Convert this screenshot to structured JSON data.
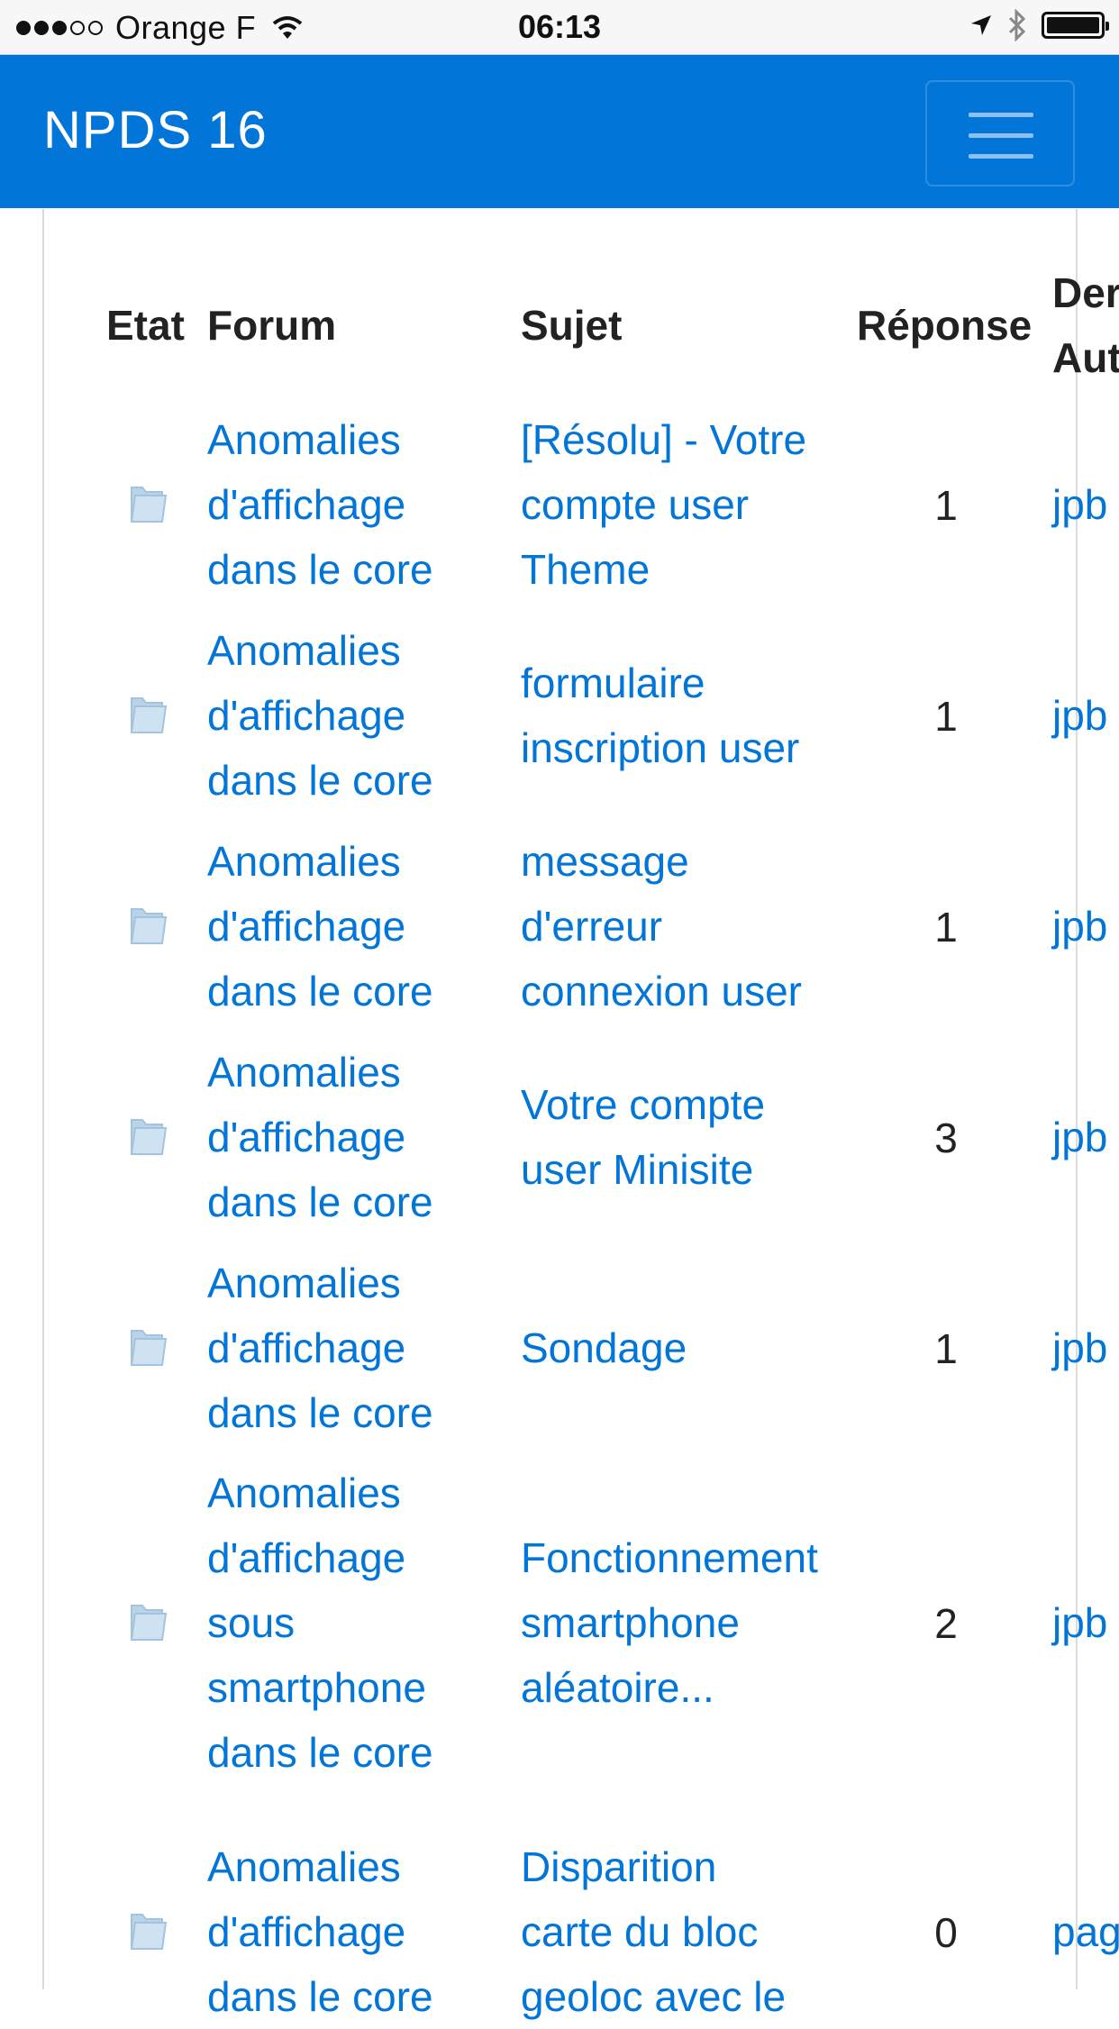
{
  "status_bar": {
    "carrier": "Orange F",
    "time": "06:13"
  },
  "navbar": {
    "brand": "NPDS  16"
  },
  "table": {
    "headers": {
      "etat": "Etat",
      "forum": "Forum",
      "sujet": "Sujet",
      "reponse": "Réponse",
      "dernier_line1": "Der",
      "dernier_line2": "Aut"
    },
    "rows": [
      {
        "forum": [
          "Anomalies",
          "d'affichage",
          "dans le core"
        ],
        "sujet": [
          "[Résolu] - Votre",
          "compte user",
          "Theme"
        ],
        "reponses": "1",
        "auteur": "jpb"
      },
      {
        "forum": [
          "Anomalies",
          "d'affichage",
          "dans le core"
        ],
        "sujet": [
          "formulaire",
          "inscription user"
        ],
        "reponses": "1",
        "auteur": "jpb"
      },
      {
        "forum": [
          "Anomalies",
          "d'affichage",
          "dans le core"
        ],
        "sujet": [
          "message",
          "d'erreur",
          "connexion user"
        ],
        "reponses": "1",
        "auteur": "jpb"
      },
      {
        "forum": [
          "Anomalies",
          "d'affichage",
          "dans le core"
        ],
        "sujet": [
          "Votre compte",
          "user Minisite"
        ],
        "reponses": "3",
        "auteur": "jpb"
      },
      {
        "forum": [
          "Anomalies",
          "d'affichage",
          "dans le core"
        ],
        "sujet": [
          "Sondage"
        ],
        "reponses": "1",
        "auteur": "jpb"
      },
      {
        "forum": [
          "Anomalies",
          "d'affichage",
          "sous",
          "smartphone",
          "dans le core"
        ],
        "sujet": [
          "Fonctionnement",
          "smartphone",
          "aléatoire..."
        ],
        "reponses": "2",
        "auteur": "jpb"
      },
      {
        "forum": [
          "Anomalies",
          "d'affichage",
          "dans le core"
        ],
        "sujet": [
          "Disparition",
          "carte du bloc",
          "geoloc avec le"
        ],
        "reponses": "0",
        "auteur": "pag"
      }
    ]
  },
  "icons": {
    "folder": "folder-icon",
    "menu": "hamburger-menu-icon",
    "wifi": "wifi-icon",
    "location": "location-arrow-icon",
    "bluetooth": "bluetooth-icon",
    "battery": "battery-icon"
  },
  "colors": {
    "navbar": "#0275d8",
    "link": "#0275d8",
    "folder": "#b9d4ea"
  }
}
